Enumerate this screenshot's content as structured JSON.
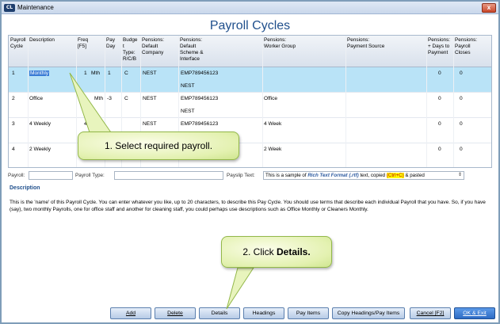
{
  "window": {
    "title": "Maintenance",
    "app_icon": "CL",
    "close_symbol": "x"
  },
  "page": {
    "title": "Payroll Cycles"
  },
  "grid": {
    "headers": {
      "payroll_cycle": "Payroll\nCycle",
      "description": "Description",
      "freq": "Freq\n[F5]",
      "pay_day": "Pay\nDay",
      "budget_type": "Budge\nt\nType:\nR/C/B",
      "pensions_default_company": "Pensions:\nDefault\nCompany",
      "pensions_default_scheme": "Pensions:\nDefault\nScheme &\nInterface",
      "pensions_worker_group": "Pensions:\nWorker Group",
      "pensions_payment_source": "Pensions:\nPayment Source",
      "pensions_days_to_payment": "Pensions:\n+ Days to\nPayment",
      "pensions_payroll_closes": "Pensions:\nPayroll\nCloses"
    },
    "rows": [
      {
        "cycle": "1",
        "description": "Monthly",
        "freq_num": "1",
        "freq_unit": "Mth",
        "pay_day": "1",
        "budget": "C",
        "company": "NEST",
        "scheme": "EMP789456123",
        "interface": "NEST",
        "worker_group": "",
        "payment_source": "",
        "days": "0",
        "closes": "0"
      },
      {
        "cycle": "2",
        "description": "Office",
        "freq_num": "",
        "freq_unit": "Mth",
        "pay_day": "-3",
        "budget": "C",
        "company": "NEST",
        "scheme": "EMP789456123",
        "interface": "NEST",
        "worker_group": "Office",
        "payment_source": "",
        "days": "0",
        "closes": "0"
      },
      {
        "cycle": "3",
        "description": "4 Weekly",
        "freq_num": "4",
        "freq_unit": "",
        "pay_day": "",
        "budget": "",
        "company": "NEST",
        "scheme": "EMP789456123",
        "interface": "",
        "worker_group": "4 Week",
        "payment_source": "",
        "days": "0",
        "closes": "0"
      },
      {
        "cycle": "4",
        "description": "2 Weekly",
        "freq_num": "",
        "freq_unit": "",
        "pay_day": "",
        "budget": "",
        "company": "",
        "scheme": "",
        "interface": "",
        "worker_group": "2 Week",
        "payment_source": "",
        "days": "0",
        "closes": "0"
      }
    ]
  },
  "form": {
    "payroll_label": "Payroll:",
    "payroll_value": "",
    "payroll_type_label": "Payroll Type:",
    "payroll_type_value": "",
    "payslip_text_label": "Payslip Text:",
    "payslip_text_part1": "This is a sample of ",
    "payslip_text_rtf": "Rich Text Format (.rtf)",
    "payslip_text_part2": " text, copied ",
    "payslip_text_ctrlc": "(Ctrl+C)",
    "payslip_text_part3": " & pasted"
  },
  "description": {
    "heading": "Description",
    "body": "This is the 'name' of this Payroll Cycle. You can enter whatever you like, up to 20 characters, to describe this Pay Cycle. You should use terms that describe each individual Payroll that you have. So, if you have (say), two monthly Payrolls, one for office staff and another for cleaning staff, you could perhaps use descriptions such as Office Monthly or Cleaners Monthly."
  },
  "buttons": {
    "add": "Add",
    "delete": "Delete",
    "details": "Details",
    "headings": "Headings",
    "pay_items": "Pay Items",
    "copy_headings": "Copy Headings/Pay Items",
    "cancel": "Cancel [F2]",
    "ok_exit": "OK & Exit"
  },
  "callouts": {
    "step1": "1. Select required payroll.",
    "step2_prefix": "2. Click ",
    "step2_bold": "Details."
  },
  "colors": {
    "selected_row": "#b9e3f7",
    "title_blue": "#1f4f8c",
    "callout_green": "#e3f1b0",
    "primary_button": "#2d6bc4"
  }
}
